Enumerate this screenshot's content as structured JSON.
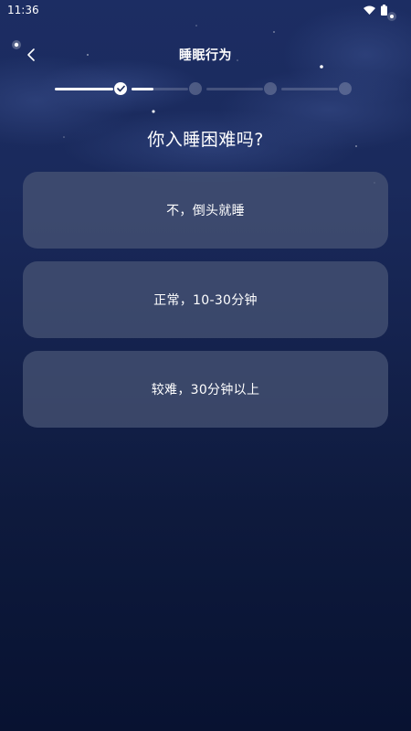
{
  "status_bar": {
    "time": "11:36"
  },
  "header": {
    "title": "睡眠行为"
  },
  "progress": {
    "total_steps": 4,
    "current_step": 2,
    "completed_steps": 1
  },
  "question": "你入睡困难吗?",
  "options": [
    {
      "label": "不，倒头就睡"
    },
    {
      "label": "正常，10-30分钟"
    },
    {
      "label": "较难，30分钟以上"
    }
  ],
  "colors": {
    "background_top": "#1c2d63",
    "background_bottom": "#081231",
    "option_bg": "#4a5676",
    "text": "#ffffff"
  },
  "icons": {
    "back": "chevron-left-icon",
    "wifi": "wifi-icon",
    "battery": "battery-icon",
    "check": "check-icon"
  }
}
